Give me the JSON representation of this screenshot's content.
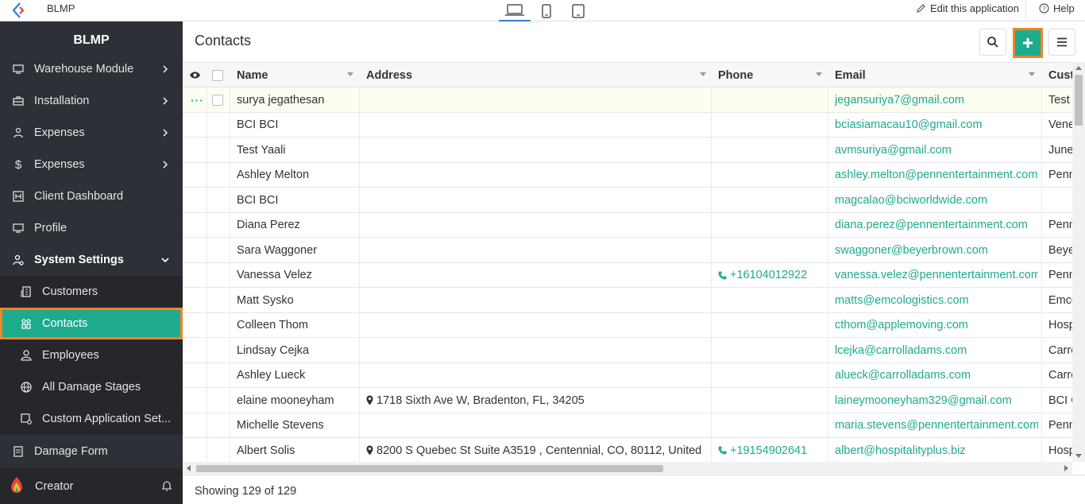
{
  "topbar": {
    "app_title": "BLMP",
    "edit_label": "Edit this application",
    "help_label": "Help"
  },
  "sidebar": {
    "title": "BLMP",
    "items": [
      {
        "label": "Warehouse Module",
        "icon": "monitor-icon",
        "chevron": "right"
      },
      {
        "label": "Installation",
        "icon": "toolbox-icon",
        "chevron": "right"
      },
      {
        "label": "Expenses",
        "icon": "users-icon",
        "chevron": "right"
      },
      {
        "label": "Expenses",
        "icon": "dollar-icon",
        "chevron": "right"
      },
      {
        "label": "Client Dashboard",
        "icon": "dashboard-icon"
      },
      {
        "label": "Profile",
        "icon": "monitor-icon"
      },
      {
        "label": "System Settings",
        "icon": "settings-user-icon",
        "chevron": "down"
      }
    ],
    "sub_items": [
      {
        "label": "Customers",
        "icon": "building-icon"
      },
      {
        "label": "Contacts",
        "icon": "contacts-icon",
        "active": true
      },
      {
        "label": "Employees",
        "icon": "person-icon"
      },
      {
        "label": "All Damage Stages",
        "icon": "globe-icon"
      },
      {
        "label": "Custom Application Set...",
        "icon": "app-settings-icon"
      }
    ],
    "after_items": [
      {
        "label": "Damage Form",
        "icon": "form-icon"
      }
    ],
    "footer_label": "Creator"
  },
  "main": {
    "title": "Contacts",
    "columns": {
      "name": "Name",
      "address": "Address",
      "phone": "Phone",
      "email": "Email",
      "customer": "Cust"
    },
    "rows": [
      {
        "name": "surya jegathesan",
        "address": "",
        "phone": "",
        "email": "jegansuriya7@gmail.com",
        "customer": "Test"
      },
      {
        "name": "BCI BCI",
        "address": "",
        "phone": "",
        "email": "bciasiamacau10@gmail.com",
        "customer": "Vene"
      },
      {
        "name": "Test Yaali",
        "address": "",
        "phone": "",
        "email": "avmsuriya@gmail.com",
        "customer": "June"
      },
      {
        "name": "Ashley Melton",
        "address": "",
        "phone": "",
        "email": "ashley.melton@pennentertainment.com",
        "customer": "Penn"
      },
      {
        "name": "BCI BCI",
        "address": "",
        "phone": "",
        "email": "magcalao@bciworldwide.com",
        "customer": ""
      },
      {
        "name": "Diana Perez",
        "address": "",
        "phone": "",
        "email": "diana.perez@pennentertainment.com",
        "customer": "Penn"
      },
      {
        "name": "Sara Waggoner",
        "address": "",
        "phone": "",
        "email": "swaggoner@beyerbrown.com",
        "customer": "Beye"
      },
      {
        "name": "Vanessa Velez",
        "address": "",
        "phone": "+16104012922",
        "email": "vanessa.velez@pennentertainment.com",
        "customer": "Penn"
      },
      {
        "name": "Matt Sysko",
        "address": "",
        "phone": "",
        "email": "matts@emcologistics.com",
        "customer": "Emco"
      },
      {
        "name": "Colleen Thom",
        "address": "",
        "phone": "",
        "email": "cthom@applemoving.com",
        "customer": "Hosp"
      },
      {
        "name": "Lindsay Cejka",
        "address": "",
        "phone": "",
        "email": "lcejka@carrolladams.com",
        "customer": "Carro"
      },
      {
        "name": "Ashley Lueck",
        "address": "",
        "phone": "",
        "email": "alueck@carrolladams.com",
        "customer": "Carro"
      },
      {
        "name": "elaine mooneyham",
        "address": "1718 Sixth Ave W, Bradenton, FL, 34205",
        "phone": "",
        "email": "laineymooneyham329@gmail.com",
        "customer": "BCI C"
      },
      {
        "name": "Michelle Stevens",
        "address": "",
        "phone": "",
        "email": "maria.stevens@pennentertainment.com",
        "customer": "Penn"
      },
      {
        "name": "Albert Solis",
        "address": "8200 S Quebec St Suite A3519 , Centennial, CO, 80112, United",
        "phone": "+19154902641",
        "email": "albert@hospitalityplus.biz",
        "customer": "Hosp"
      }
    ],
    "footer_text": "Showing 129 of 129"
  },
  "colors": {
    "accent": "#1eab8d",
    "highlight": "#f2842a",
    "sidebar_bg": "#2d3036"
  }
}
